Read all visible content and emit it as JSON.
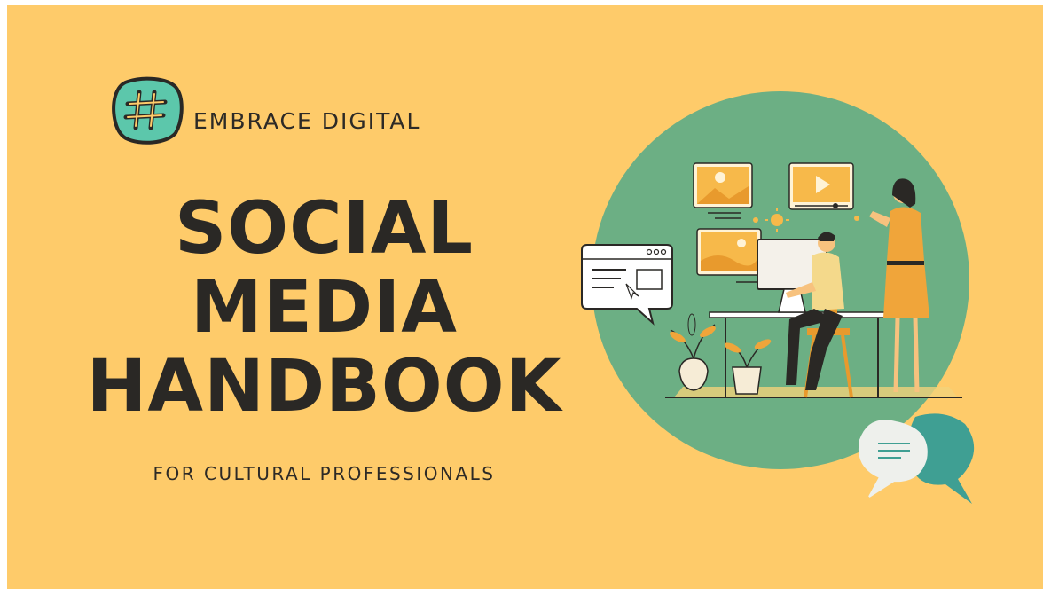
{
  "brand": {
    "logo_icon": "hashtag-icon",
    "name": "EMBRACE DIGITAL"
  },
  "title_lines": [
    "SOCIAL",
    "MEDIA",
    "HANDBOOK"
  ],
  "subtitle": "FOR CULTURAL PROFESSIONALS",
  "colors": {
    "background": "#fecb6a",
    "text": "#2a2825",
    "circle": "#6caf84",
    "badge": "#5cc7ab",
    "accent_orange": "#f0a53a"
  },
  "illustration": {
    "subject": "person-at-desktop-computer-with-colleague",
    "icons": [
      "image-card-icon",
      "video-play-card-icon",
      "browser-speech-bubble-icon",
      "chat-bubbles-icon",
      "potted-plant-icon"
    ]
  }
}
